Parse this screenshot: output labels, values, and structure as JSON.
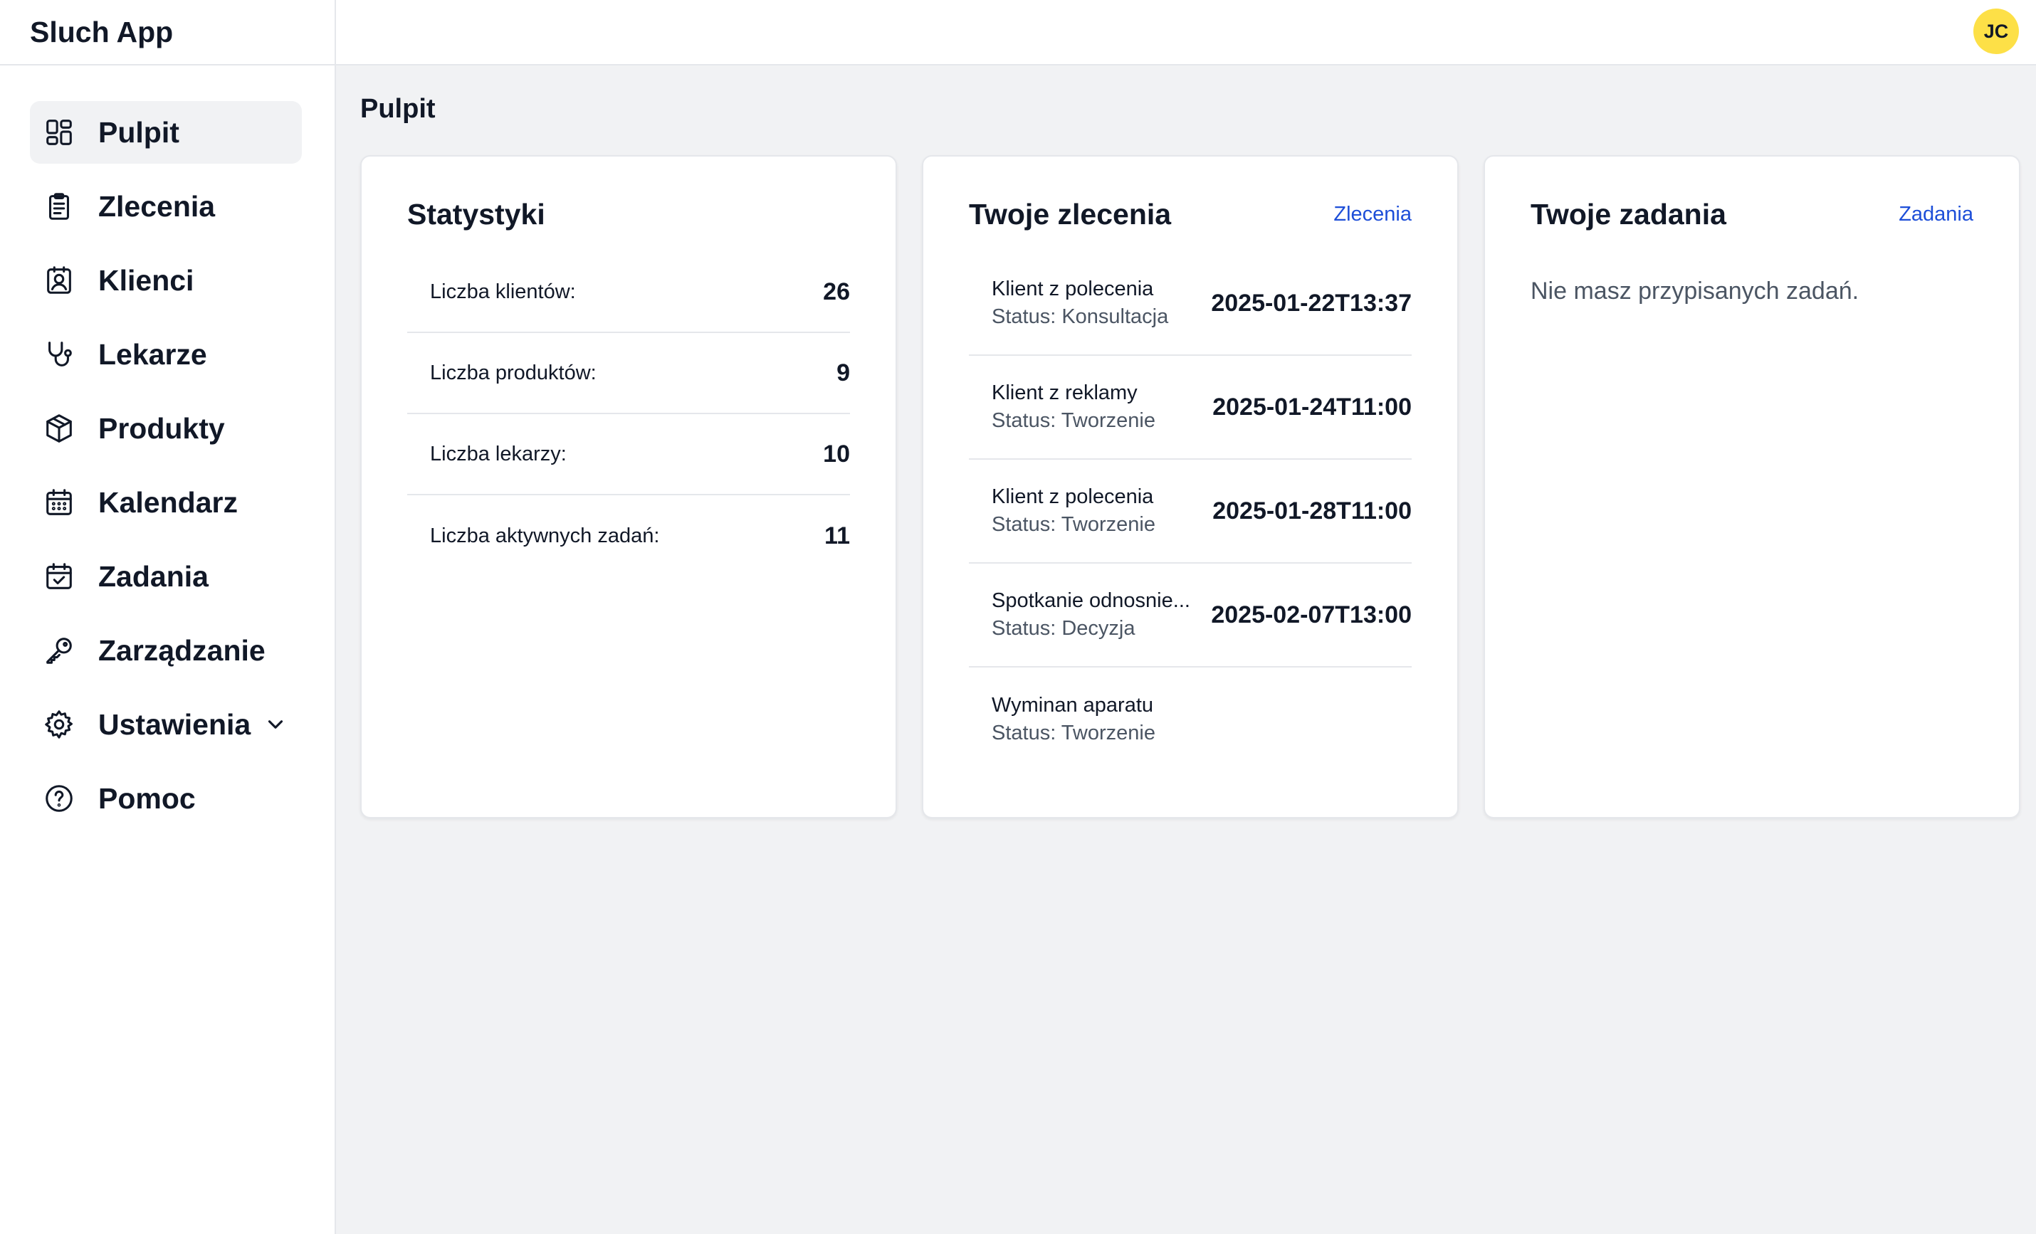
{
  "app": {
    "title": "Sluch App"
  },
  "user": {
    "initials": "JC",
    "avatar_color": "#fde047"
  },
  "sidebar": {
    "items": [
      {
        "label": "Pulpit",
        "icon": "dashboard-icon",
        "active": true
      },
      {
        "label": "Zlecenia",
        "icon": "clipboard-icon"
      },
      {
        "label": "Klienci",
        "icon": "contact-icon"
      },
      {
        "label": "Lekarze",
        "icon": "stethoscope-icon"
      },
      {
        "label": "Produkty",
        "icon": "cube-icon"
      },
      {
        "label": "Kalendarz",
        "icon": "calendar-icon"
      },
      {
        "label": "Zadania",
        "icon": "calendar-check-icon"
      },
      {
        "label": "Zarządzanie",
        "icon": "key-icon"
      },
      {
        "label": "Ustawienia",
        "icon": "gear-icon",
        "expandable": true
      },
      {
        "label": "Pomoc",
        "icon": "help-icon"
      }
    ]
  },
  "main": {
    "page_title": "Pulpit",
    "stats_card": {
      "title": "Statystyki",
      "rows": [
        {
          "label": "Liczba klientów:",
          "value": "26"
        },
        {
          "label": "Liczba produktów:",
          "value": "9"
        },
        {
          "label": "Liczba lekarzy:",
          "value": "10"
        },
        {
          "label": "Liczba aktywnych zadań:",
          "value": "11"
        }
      ]
    },
    "orders_card": {
      "title": "Twoje zlecenia",
      "link": "Zlecenia",
      "orders": [
        {
          "name": "Klient z polecenia",
          "status": "Status: Konsultacja",
          "date": "2025-01-22T13:37"
        },
        {
          "name": "Klient z reklamy",
          "status": "Status: Tworzenie",
          "date": "2025-01-24T11:00"
        },
        {
          "name": "Klient z polecenia",
          "status": "Status: Tworzenie",
          "date": "2025-01-28T11:00"
        },
        {
          "name": "Spotkanie odnosnie...",
          "status": "Status: Decyzja",
          "date": "2025-02-07T13:00"
        },
        {
          "name": "Wyminan aparatu",
          "status": "Status: Tworzenie",
          "date": ""
        }
      ]
    },
    "tasks_card": {
      "title": "Twoje zadania",
      "link": "Zadania",
      "empty_message": "Nie masz przypisanych zadań."
    }
  },
  "colors": {
    "link": "#1d4ed8",
    "background": "#f1f2f4",
    "active_nav": "#f1f2f4"
  }
}
